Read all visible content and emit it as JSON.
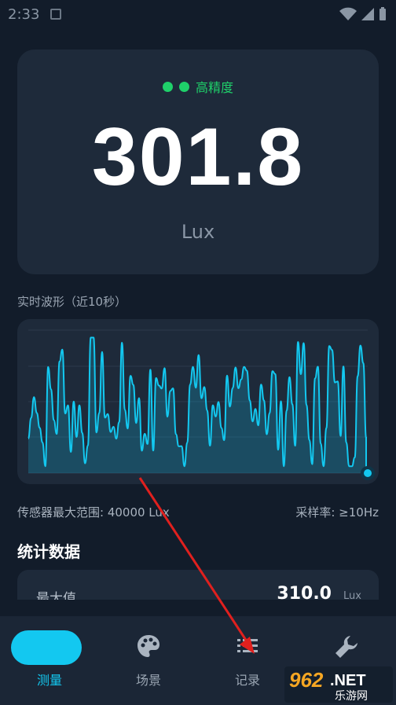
{
  "status_bar": {
    "time": "2:33"
  },
  "reading": {
    "precision_label": "高精度",
    "value": "301.8",
    "unit": "Lux"
  },
  "waveform": {
    "title": "实时波形（近10秒）"
  },
  "sensor": {
    "max_range": "传感器最大范围: 40000 Lux",
    "sample_rate": "采样率: ≥10Hz"
  },
  "stats": {
    "title": "统计数据",
    "max_label": "最大值",
    "max_value": "310.0",
    "max_unit": "Lux"
  },
  "nav": {
    "items": [
      {
        "label": "测量",
        "icon": "gauge-icon",
        "active": true
      },
      {
        "label": "场景",
        "icon": "palette-icon",
        "active": false
      },
      {
        "label": "记录",
        "icon": "list-icon",
        "active": false
      },
      {
        "label": "工具",
        "icon": "wrench-icon",
        "active": false
      }
    ]
  },
  "watermark": {
    "text": "962.NET",
    "subtext": "乐游网"
  },
  "colors": {
    "accent": "#13c8f0",
    "good": "#1fd06a",
    "background": "#121c2a",
    "card": "#1e2a3a",
    "annotation": "#e0201e"
  }
}
